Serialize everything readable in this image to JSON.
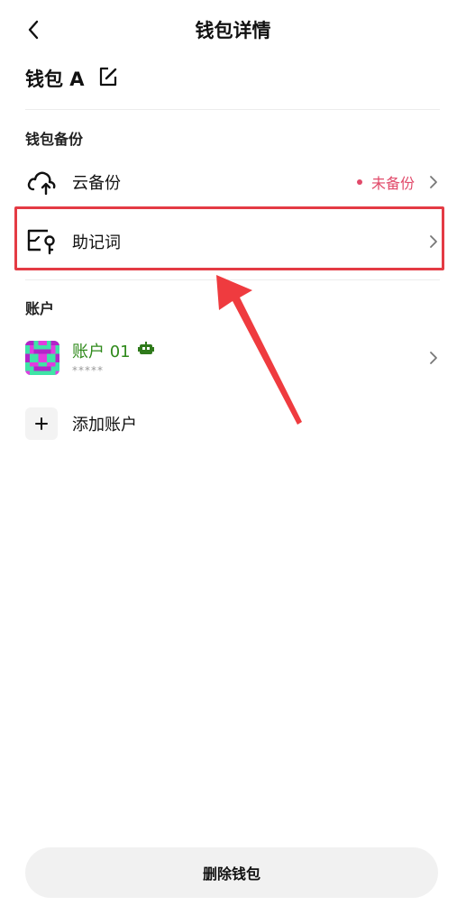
{
  "header": {
    "title": "钱包详情"
  },
  "wallet": {
    "name": "钱包 A"
  },
  "backup_section": {
    "label": "钱包备份",
    "items": [
      {
        "label": "云备份",
        "status": "未备份",
        "icon": "cloud-upload-icon"
      },
      {
        "label": "助记词",
        "icon": "mnemonic-key-icon"
      }
    ]
  },
  "accounts_section": {
    "label": "账户",
    "account": {
      "name": "账户 01",
      "sub": "*****",
      "badge_icon": "robot-icon"
    },
    "add_label": "添加账户"
  },
  "footer": {
    "delete_label": "删除钱包"
  },
  "colors": {
    "accent_red": "#e43b44",
    "status_red": "#e14a6a",
    "account_green": "#2f8a1b"
  }
}
